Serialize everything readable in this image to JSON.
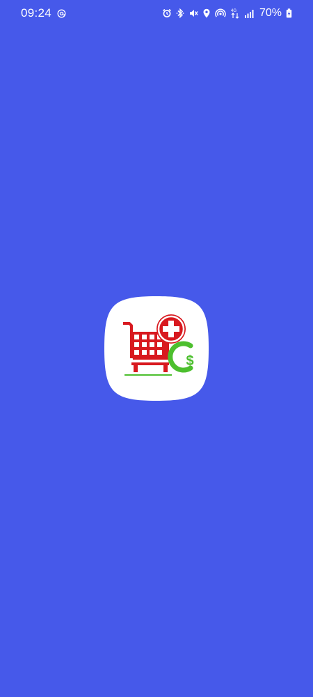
{
  "screen": {
    "background": "#4659EA"
  },
  "status_bar": {
    "time": "09:24",
    "battery_percent": "70%",
    "left_icons": [
      "at-sign-notification-icon"
    ],
    "right_icons": [
      "alarm-icon",
      "bluetooth-icon",
      "vibrate-mute-icon",
      "location-icon",
      "hotspot-icon",
      "mobile-data-icon",
      "signal-icon",
      "battery-charging-icon"
    ]
  },
  "splash": {
    "icon": "shopping-cart-with-plus-and-dollar-icon",
    "colors": {
      "tile": "#FFFFFF",
      "cart": "#D8191F",
      "plus_badge": "#D8191F",
      "dollar": "#4CBF2E"
    }
  }
}
